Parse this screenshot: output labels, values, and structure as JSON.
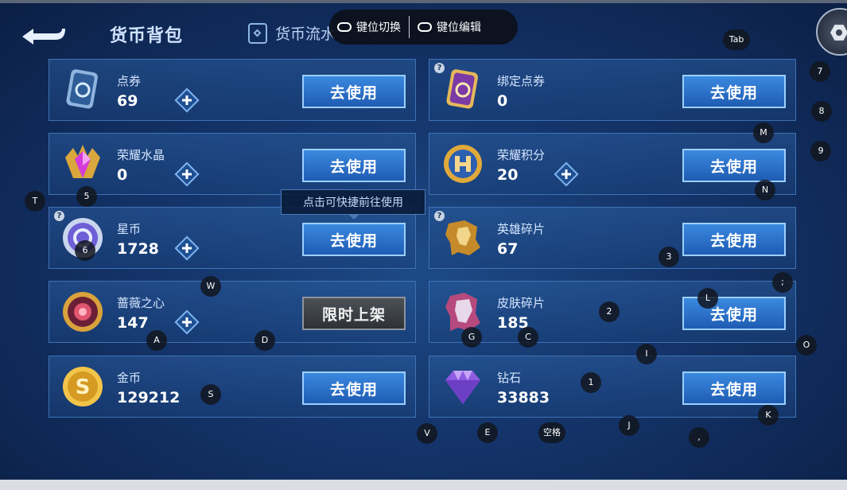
{
  "header": {
    "title": "货币背包",
    "flow_tab": "货币流水"
  },
  "overlay": {
    "switch_label": "键位切换",
    "edit_label": "键位编辑"
  },
  "tooltip": "点击可快捷前往使用",
  "use_label": "去使用",
  "limited_label": "限时上架",
  "currencies": [
    {
      "name": "点券",
      "amount": "69"
    },
    {
      "name": "绑定点券",
      "amount": "0"
    },
    {
      "name": "荣耀水晶",
      "amount": "0"
    },
    {
      "name": "荣耀积分",
      "amount": "20"
    },
    {
      "name": "星币",
      "amount": "1728"
    },
    {
      "name": "英雄碎片",
      "amount": "67"
    },
    {
      "name": "蔷薇之心",
      "amount": "147"
    },
    {
      "name": "皮肤碎片",
      "amount": "185"
    },
    {
      "name": "金币",
      "amount": "129212"
    },
    {
      "name": "钻石",
      "amount": "33883"
    }
  ],
  "help_mark": "?",
  "keys": [
    "Tab",
    "7",
    "8",
    "M",
    "9",
    "N",
    "T",
    "5",
    "6",
    "3",
    "W",
    ";",
    "L",
    "2",
    "A",
    "D",
    "G",
    "C",
    "I",
    "O",
    "1",
    "S",
    "K",
    "J",
    "V",
    "E",
    "空格",
    ","
  ],
  "colors": {
    "accent": "#3b89e0",
    "background": "#14346a",
    "card_border": "#3f72b4"
  }
}
